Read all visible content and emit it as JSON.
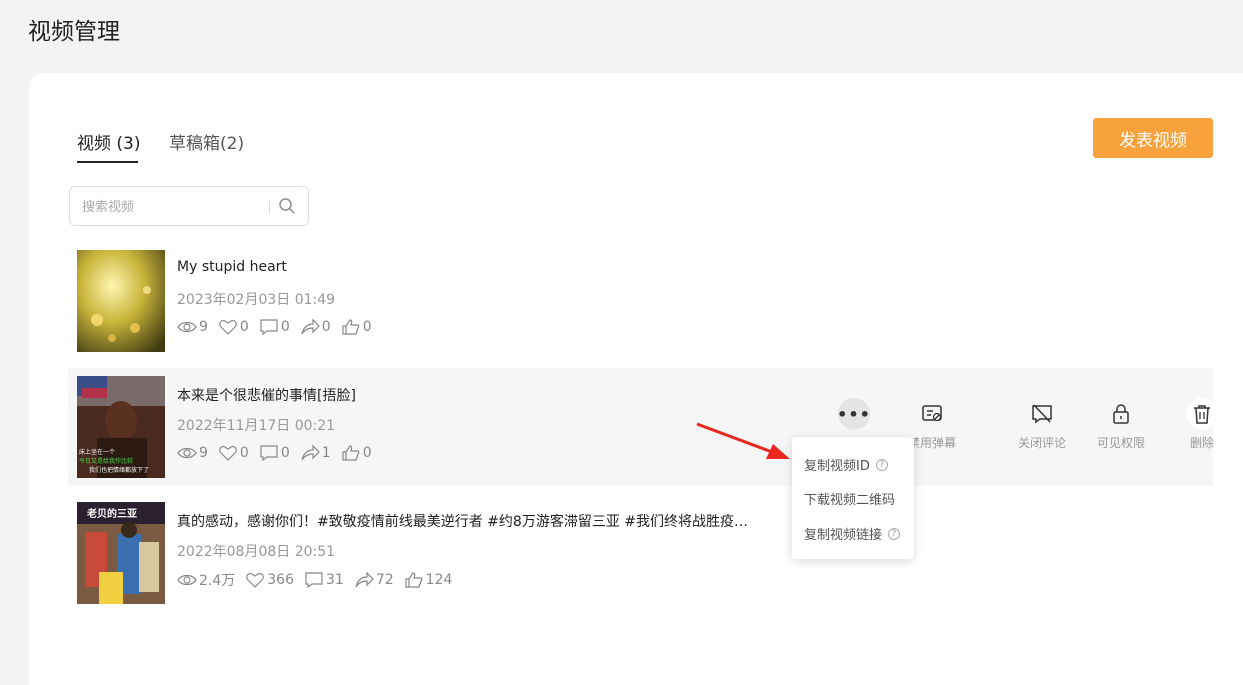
{
  "page": {
    "title": "视频管理"
  },
  "tabs": [
    {
      "label": "视频 (3)",
      "active": true
    },
    {
      "label": "草稿箱(2)",
      "active": false
    }
  ],
  "toolbar": {
    "publish_label": "发表视频"
  },
  "search": {
    "placeholder": "搜索视频",
    "value": ""
  },
  "videos": [
    {
      "title": "My stupid heart",
      "date": "2023年02月03日 01:49",
      "views": "9",
      "likes": "0",
      "comments": "0",
      "shares": "0",
      "thumbs": "0"
    },
    {
      "title": "本来是个很悲催的事情[捂脸]",
      "date": "2022年11月17日 00:21",
      "views": "9",
      "likes": "0",
      "comments": "0",
      "shares": "1",
      "thumbs": "0"
    },
    {
      "title": "真的感动，感谢你们！#致敬疫情前线最美逆行者 #约8万游客滞留三亚 #我们终将战胜疫…",
      "date": "2022年08月08日 20:51",
      "views": "2.4万",
      "likes": "366",
      "comments": "31",
      "shares": "72",
      "thumbs": "124"
    }
  ],
  "row_actions": [
    {
      "label": "禁用弹幕",
      "icon": "danmaku-icon"
    },
    {
      "label": "关闭评论",
      "icon": "comment-off-icon"
    },
    {
      "label": "可见权限",
      "icon": "lock-icon"
    },
    {
      "label": "删除",
      "icon": "trash-icon"
    }
  ],
  "more_menu": [
    {
      "label": "复制视频ID",
      "help": true
    },
    {
      "label": "下载视频二维码",
      "help": false
    },
    {
      "label": "复制视频链接",
      "help": true
    }
  ],
  "thumb_captions": {
    "video2_lines": [
      "床上坐在一个",
      "今日又是给我作比较",
      "我们也把情绪都放下了"
    ],
    "video3_line": "老贝的三亚"
  },
  "colors": {
    "accent": "#f7a23c",
    "arrow": "#e8271f"
  }
}
